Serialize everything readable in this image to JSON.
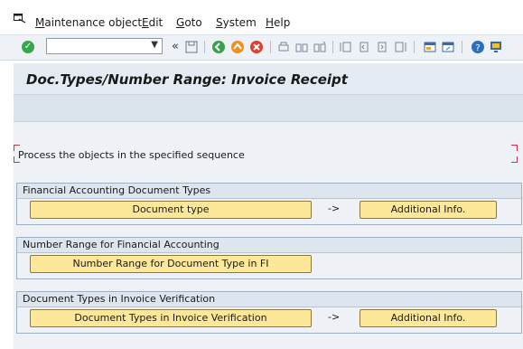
{
  "menu": {
    "items": [
      {
        "accel": "M",
        "rest": "aintenance object"
      },
      {
        "accel": "E",
        "rest": "dit"
      },
      {
        "accel": "G",
        "rest": "oto"
      },
      {
        "accel": "S",
        "rest": "ystem"
      },
      {
        "accel": "H",
        "rest": "elp"
      }
    ]
  },
  "toolbar": {
    "command_field_value": "",
    "icons": [
      "ok-icon",
      "command-dropdown-icon",
      "back-arrows-icon",
      "save-icon",
      "back-icon",
      "exit-icon",
      "cancel-icon",
      "print-icon",
      "find-icon",
      "find-next-icon",
      "first-page-icon",
      "previous-page-icon",
      "next-page-icon",
      "last-page-icon",
      "new-session-icon",
      "shortcut-icon",
      "help-icon",
      "layout-icon"
    ],
    "back_glyph": "«"
  },
  "title": "Doc.Types/Number Range: Invoice Receipt",
  "instruction": "Process the objects in the specified sequence",
  "groups": [
    {
      "title": "Financial Accounting Document Types",
      "primary_button": "Document type",
      "arrow": "->",
      "secondary_button": "Additional Info."
    },
    {
      "title": "Number Range for Financial Accounting",
      "primary_button": "Number Range for Document Type in FI"
    },
    {
      "title": "Document Types in Invoice Verification",
      "primary_button": "Document Types in Invoice Verification",
      "arrow": "->",
      "secondary_button": "Additional Info."
    }
  ],
  "colors": {
    "ok": "#37a848",
    "button_bg": "#fde89a",
    "frame_marker": "#c8334a"
  }
}
